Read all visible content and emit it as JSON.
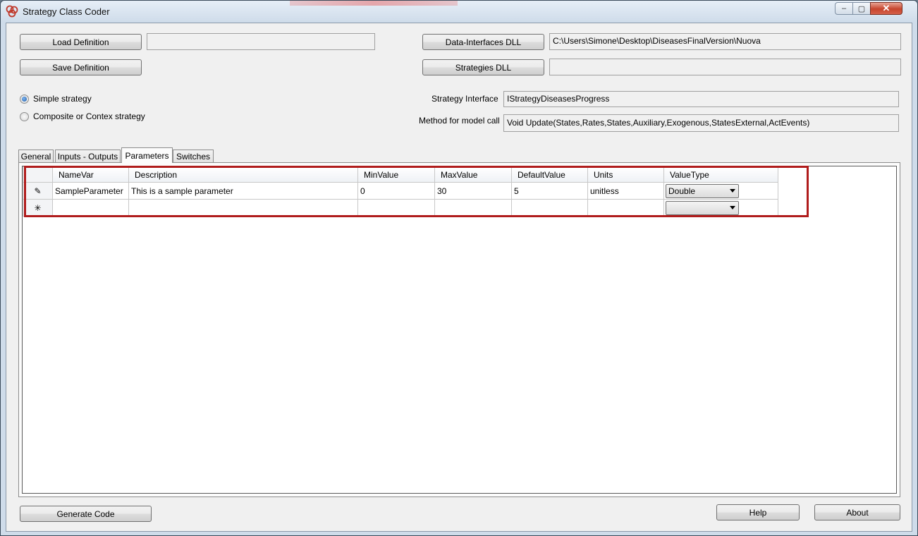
{
  "window": {
    "title": "Strategy Class Coder",
    "controls": {
      "minimize": "–",
      "maximize": "▢",
      "close": "✕"
    }
  },
  "definition": {
    "load_label": "Load Definition",
    "load_path": "",
    "save_label": "Save Definition"
  },
  "dll": {
    "data_interfaces_label": "Data-Interfaces DLL",
    "data_interfaces_path": "C:\\Users\\Simone\\Desktop\\DiseasesFinalVersion\\Nuova",
    "strategies_label": "Strategies DLL",
    "strategies_path": ""
  },
  "strategy_type": {
    "simple_label": "Simple strategy",
    "composite_label": "Composite or Contex strategy",
    "selected": "simple"
  },
  "interface": {
    "label": "Strategy Interface",
    "value": "IStrategyDiseasesProgress"
  },
  "method": {
    "label": "Method for model call",
    "value": "Void Update(States,Rates,States,Auxiliary,Exogenous,StatesExternal,ActEvents)"
  },
  "tabs": [
    {
      "label": "General"
    },
    {
      "label": "Inputs - Outputs"
    },
    {
      "label": "Parameters"
    },
    {
      "label": "Switches"
    }
  ],
  "active_tab": "Parameters",
  "grid": {
    "columns": [
      "NameVar",
      "Description",
      "MinValue",
      "MaxValue",
      "DefaultValue",
      "Units",
      "ValueType"
    ],
    "rows": [
      {
        "indicator": "✎",
        "NameVar": "SampleParameter",
        "Description": "This is a sample parameter",
        "MinValue": "0",
        "MaxValue": "30",
        "DefaultValue": "5",
        "Units": "unitless",
        "ValueType": "Double"
      }
    ],
    "new_row_indicator": "✳",
    "new_row_value_type": ""
  },
  "footer": {
    "generate_label": "Generate Code",
    "help_label": "Help",
    "about_label": "About"
  },
  "colors": {
    "highlight_border": "#b01c1c",
    "window_frame": "#cfdcea"
  },
  "icons": [
    "app-icon",
    "pencil-icon",
    "new-row-icon",
    "dropdown-arrow-icon"
  ]
}
